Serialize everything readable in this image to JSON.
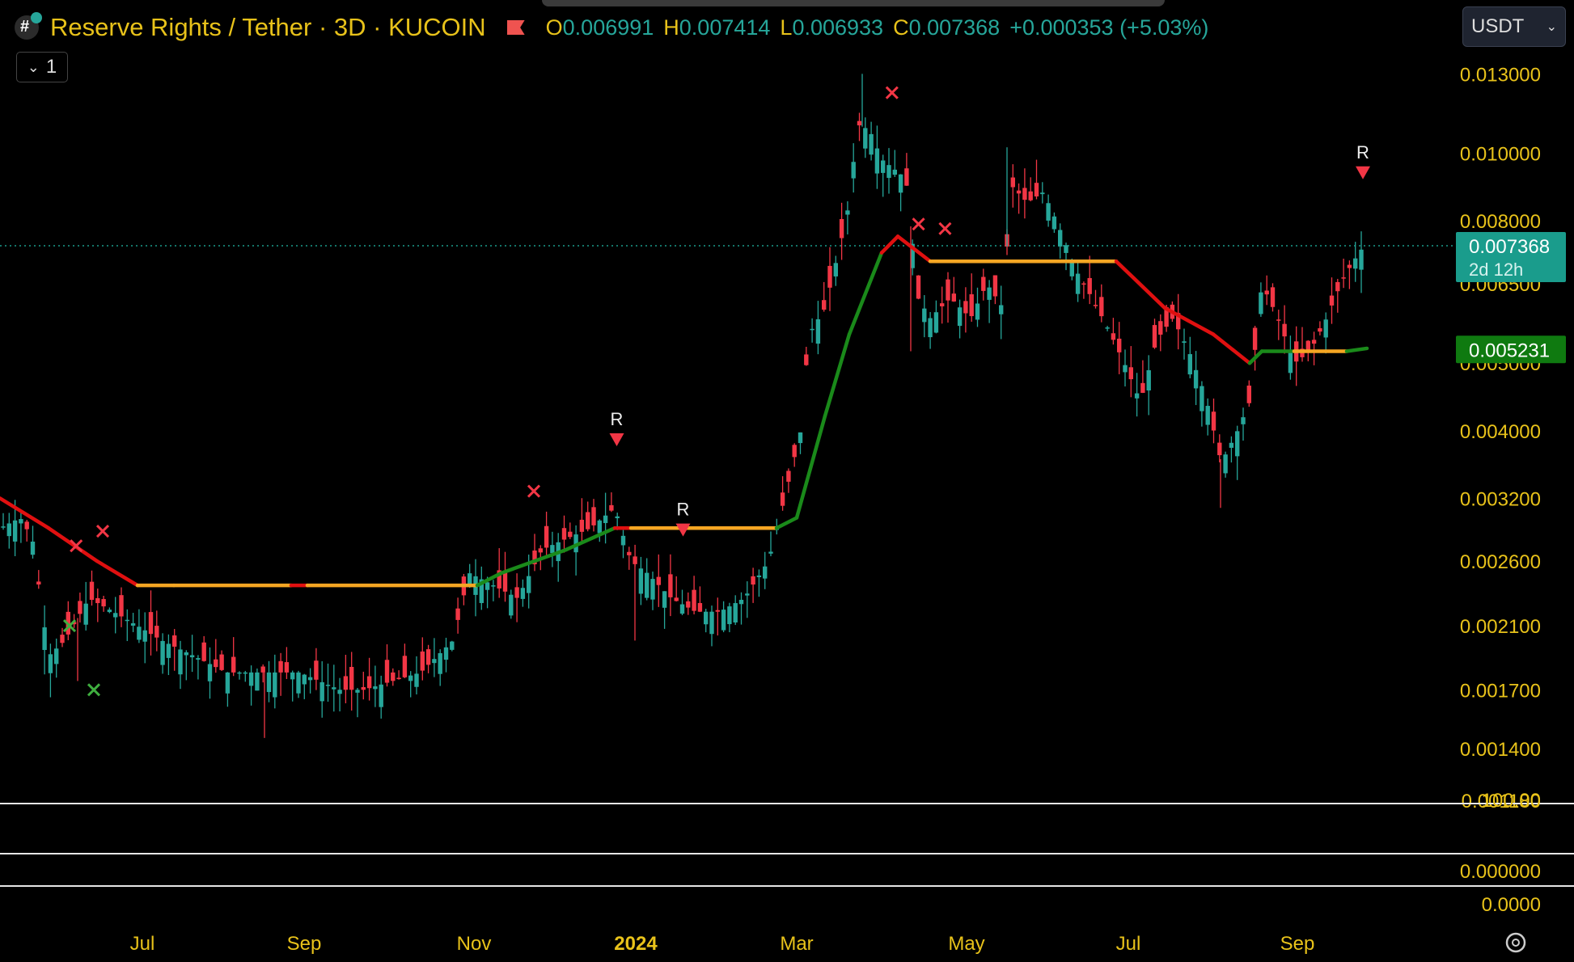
{
  "header": {
    "title": "Reserve Rights / Tether · 3D · KUCOIN",
    "ohlc": [
      {
        "k": "O",
        "v": "0.006991"
      },
      {
        "k": "H",
        "v": "0.007414"
      },
      {
        "k": "L",
        "v": "0.006933"
      },
      {
        "k": "C",
        "v": "0.007368"
      },
      {
        "k": "",
        "v": "+0.000353 (+5.03%)"
      }
    ],
    "collapse_label": "1",
    "currency": "USDT"
  },
  "colors": {
    "up": "#26a69a",
    "down": "#f23645",
    "axis_text": "#e8c21a",
    "trend_down": "#e01010",
    "trend_up": "#1a8a1a",
    "flat": "#f5a623"
  },
  "price_badges": [
    {
      "value": "0.007368",
      "sub": "2d 12h",
      "color": "#1a9c8c"
    },
    {
      "value": "0.005231",
      "sub": "",
      "color": "#0f7a10"
    }
  ],
  "chart_data": {
    "type": "candlestick",
    "scale": "log",
    "ylim": [
      0.00118,
      0.0134
    ],
    "y_ticks": [
      "0.013000",
      "0.010000",
      "0.008000",
      "0.006500",
      "0.005000",
      "0.004000",
      "0.003200",
      "0.002600",
      "0.002100",
      "0.001700",
      "0.001400",
      "0.001180"
    ],
    "x_labels": [
      "Jul",
      "Sep",
      "Nov",
      "2024",
      "Mar",
      "May",
      "Jul",
      "Sep"
    ],
    "sub_pane_ticks": [
      "100.00",
      "0.000000",
      "0.0000"
    ],
    "last_price": 0.007368,
    "trendline_level": 0.005231,
    "markers": [
      {
        "type": "x",
        "label": "",
        "date_index": 22
      },
      {
        "type": "x",
        "label": "",
        "date_index": 30
      },
      {
        "type": "x",
        "label": "",
        "date_index": 160
      },
      {
        "type": "r",
        "label": "R",
        "date_index": 185
      },
      {
        "type": "r",
        "label": "R",
        "date_index": 205
      },
      {
        "type": "x",
        "label": "",
        "date_index": 268
      },
      {
        "type": "x",
        "label": "",
        "date_index": 276
      },
      {
        "type": "x",
        "label": "",
        "date_index": 284
      },
      {
        "type": "r",
        "label": "R",
        "date_index": 410
      }
    ]
  }
}
